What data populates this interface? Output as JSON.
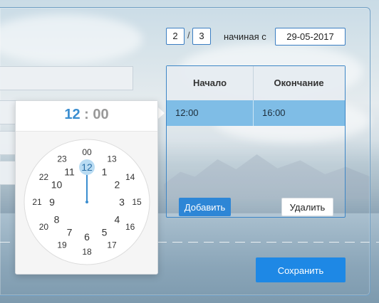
{
  "pagination": {
    "current": "2",
    "separator": "/",
    "total": "3"
  },
  "start": {
    "label": "начиная с",
    "date": "29-05-2017"
  },
  "table": {
    "headers": [
      "Начало",
      "Окончание"
    ],
    "rows": [
      {
        "start": "12:00",
        "end": "16:00"
      }
    ]
  },
  "buttons": {
    "add": "Добавить",
    "delete": "Удалить",
    "save": "Сохранить"
  },
  "clock": {
    "hours": "12",
    "separator": ":",
    "minutes": "00",
    "selected_hour": "12",
    "outer_ring": [
      "00",
      "13",
      "14",
      "15",
      "16",
      "17",
      "18",
      "19",
      "20",
      "21",
      "22",
      "23"
    ],
    "inner_ring": [
      "12",
      "1",
      "2",
      "3",
      "4",
      "5",
      "6",
      "7",
      "8",
      "9",
      "10",
      "11"
    ]
  },
  "colors": {
    "accent": "#1e88e5",
    "selection": "#7fbde6",
    "clock_accent": "#3b8ed0"
  }
}
